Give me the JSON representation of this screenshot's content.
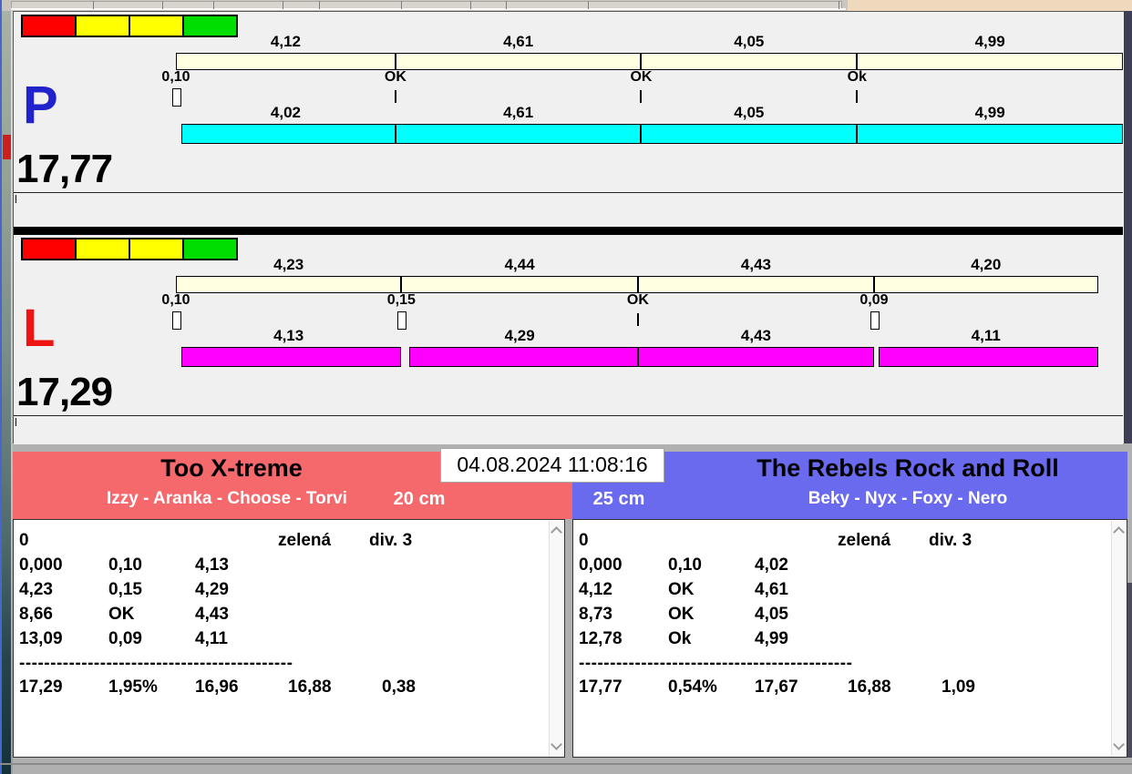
{
  "panels": [
    {
      "id": "P",
      "letter": "P",
      "letter_color": "#2222cc",
      "total": "17,77",
      "indicator_colors": [
        "#ff0000",
        "#ffff00",
        "#ffff00",
        "#00dd00"
      ],
      "ref_bar_color": "#ffffe1",
      "run_color": "#00ffff",
      "ref_labels": [
        "4,12",
        "4,61",
        "4,05",
        "4,99"
      ],
      "ref_values": [
        4.12,
        4.61,
        4.05,
        4.99
      ],
      "marks": [
        {
          "label": "0,10",
          "type": "box"
        },
        {
          "label": "OK",
          "type": "line"
        },
        {
          "label": "OK",
          "type": "line"
        },
        {
          "label": "Ok",
          "type": "line"
        }
      ],
      "run_labels": [
        "4,02",
        "4,61",
        "4,05",
        "4,99"
      ],
      "run_values": [
        4.02,
        4.61,
        4.05,
        4.99
      ],
      "penalties": [
        0.1,
        0,
        0,
        0
      ]
    },
    {
      "id": "L",
      "letter": "L",
      "letter_color": "#ee1414",
      "total": "17,29",
      "indicator_colors": [
        "#ff0000",
        "#ffff00",
        "#ffff00",
        "#00dd00"
      ],
      "ref_bar_color": "#ffffe1",
      "run_color": "#ff00ff",
      "ref_labels": [
        "4,23",
        "4,44",
        "4,43",
        "4,20"
      ],
      "ref_values": [
        4.23,
        4.44,
        4.43,
        4.2
      ],
      "marks": [
        {
          "label": "0,10",
          "type": "box"
        },
        {
          "label": "0,15",
          "type": "box"
        },
        {
          "label": "OK",
          "type": "line"
        },
        {
          "label": "0,09",
          "type": "box"
        }
      ],
      "run_labels": [
        "4,13",
        "4,29",
        "4,43",
        "4,11"
      ],
      "run_values": [
        4.13,
        4.29,
        4.43,
        4.11
      ],
      "penalties": [
        0.1,
        0.15,
        0,
        0.09
      ]
    }
  ],
  "timestamp": "04.08.2024 11:08:16",
  "teams": [
    {
      "side": "left",
      "name": "Too X-treme",
      "members": "Izzy - Aranka - Choose - Torvi",
      "jump_height": "20 cm",
      "header_color": "#f5686c",
      "table": {
        "info_row": [
          "0",
          "zelená",
          "div. 3"
        ],
        "splits": [
          [
            "0,000",
            "0,10",
            "4,13"
          ],
          [
            "4,23",
            "0,15",
            "4,29"
          ],
          [
            "8,66",
            "OK",
            "4,43"
          ],
          [
            "13,09",
            "0,09",
            "4,11"
          ]
        ],
        "separator": "--------------------------------------------",
        "totals": [
          "17,29",
          "1,95%",
          "16,96",
          "16,88",
          "0,38"
        ]
      }
    },
    {
      "side": "right",
      "name": "The Rebels Rock and Roll",
      "members": "Beky - Nyx - Foxy - Nero",
      "jump_height": "25 cm",
      "header_color": "#6a6aee",
      "table": {
        "info_row": [
          "0",
          "zelená",
          "div. 3"
        ],
        "splits": [
          [
            "0,000",
            "0,10",
            "4,02"
          ],
          [
            "4,12",
            "OK",
            "4,61"
          ],
          [
            "8,73",
            "OK",
            "4,05"
          ],
          [
            "12,78",
            "Ok",
            "4,99"
          ]
        ],
        "separator": "--------------------------------------------",
        "totals": [
          "17,77",
          "0,54%",
          "17,67",
          "16,88",
          "1,09"
        ]
      }
    }
  ]
}
